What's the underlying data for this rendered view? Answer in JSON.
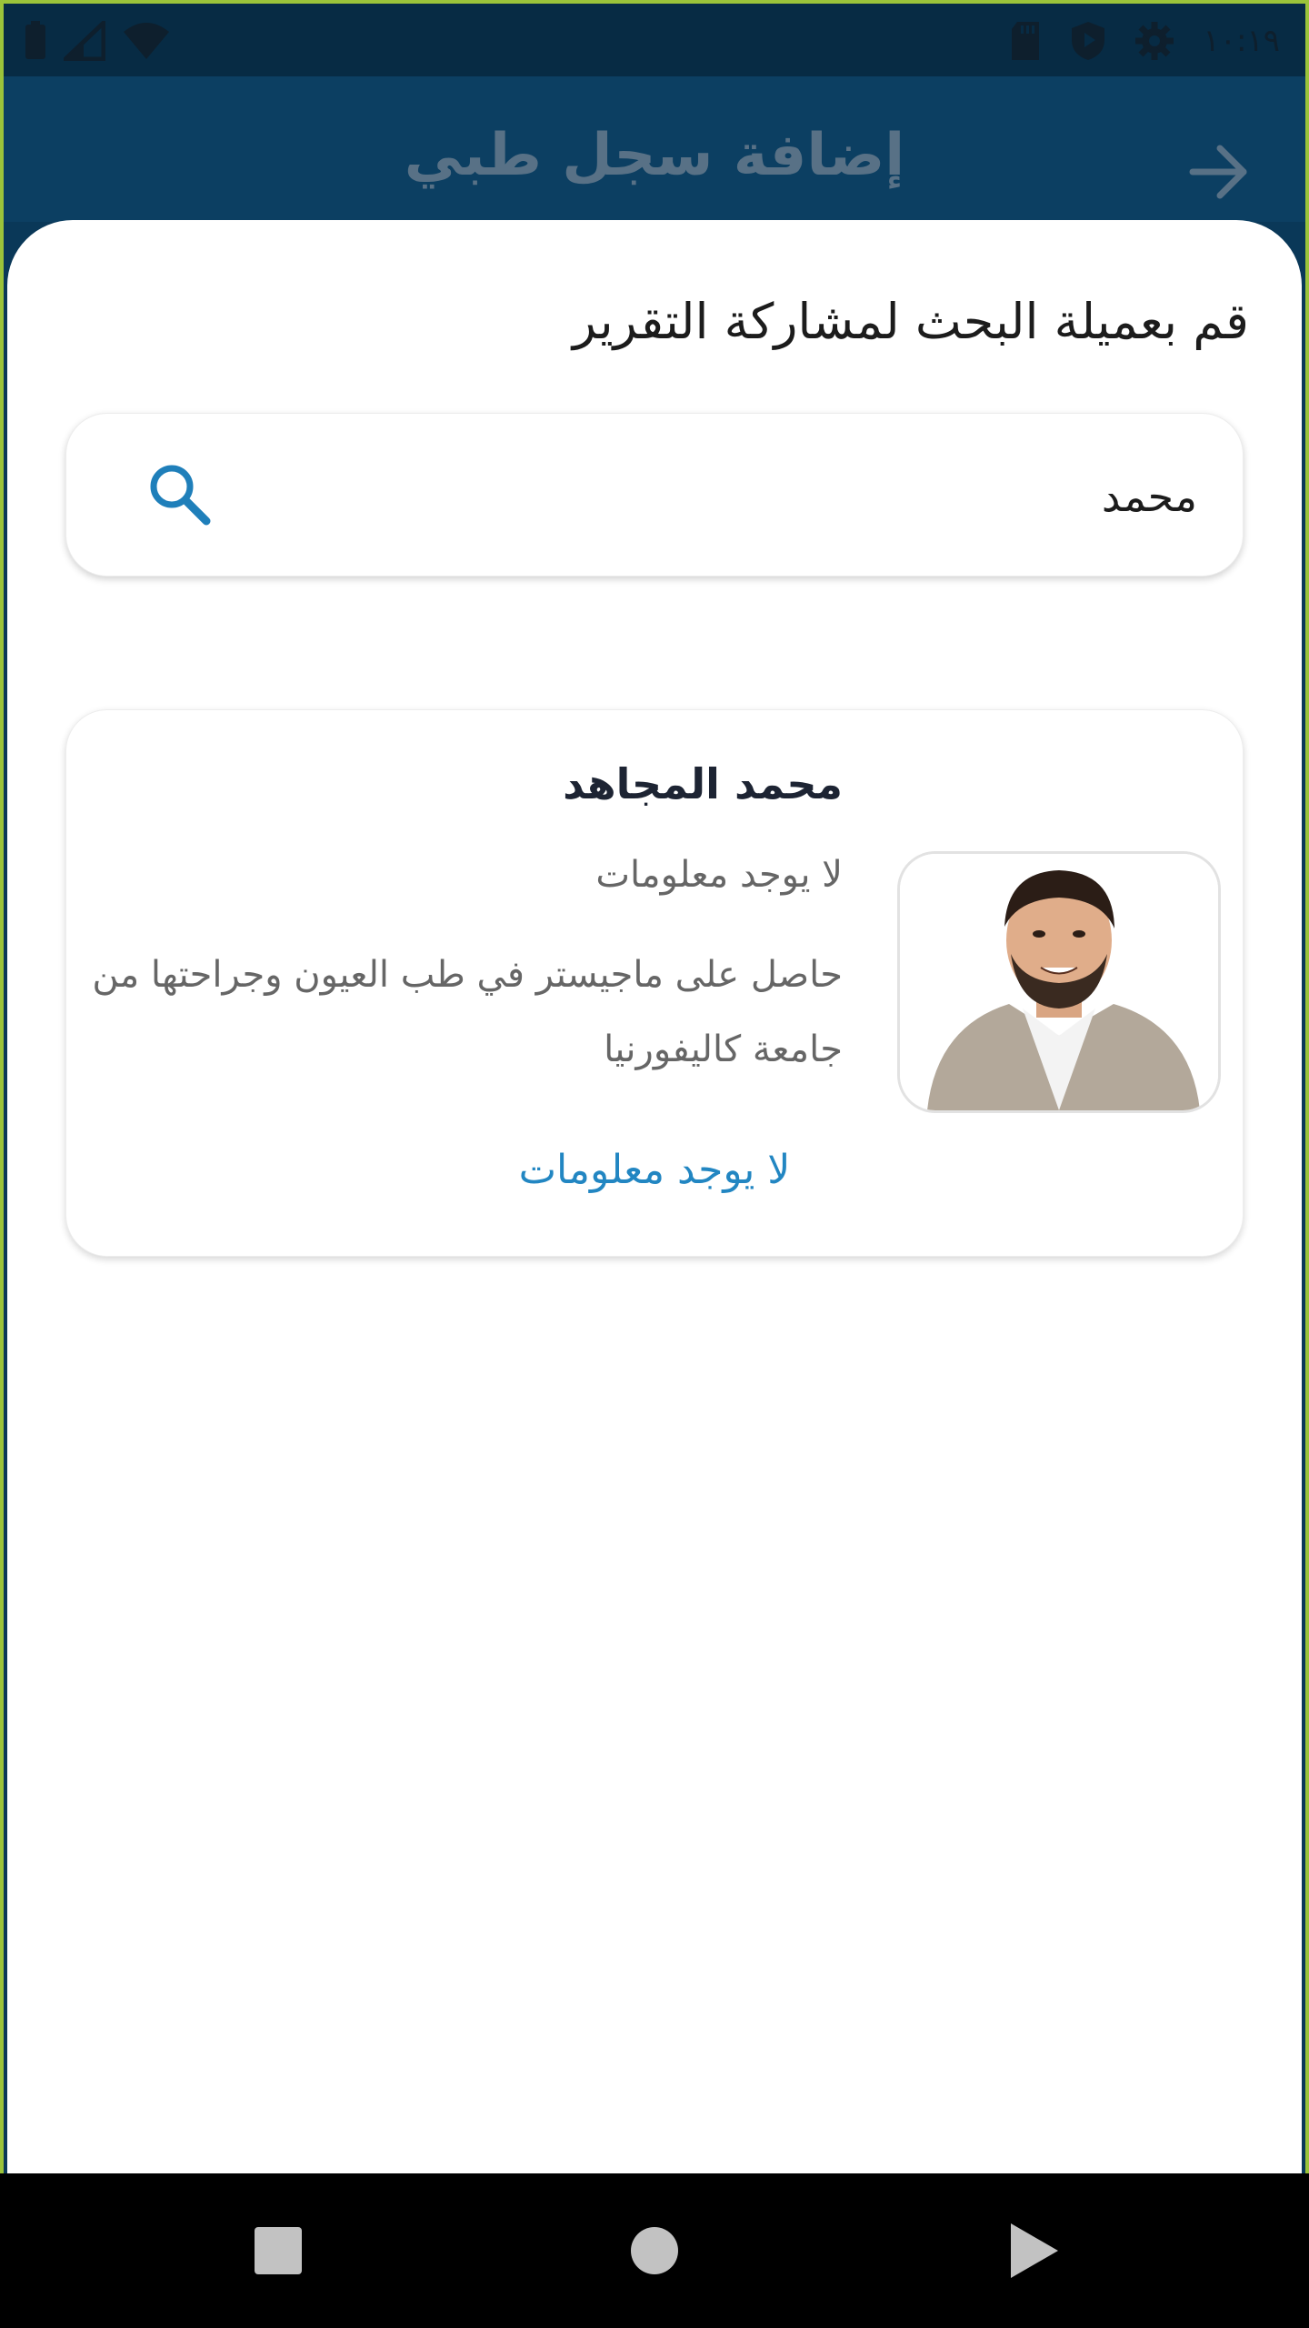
{
  "status_bar": {
    "time": "١٠:١٩",
    "left_icons": [
      "battery-icon",
      "signal-icon",
      "wifi-icon"
    ],
    "right_icons": [
      "sd-card-icon",
      "shield-icon",
      "gear-icon"
    ]
  },
  "app_bar": {
    "title": "إضافة سجل طبي",
    "back_icon": "arrow-right-icon"
  },
  "sheet": {
    "title": "قم بعميلة البحث لمشاركة التقرير",
    "search": {
      "value": "محمد",
      "placeholder": ""
    },
    "result": {
      "name": "محمد المجاهد",
      "specialty": "لا يوجد معلومات",
      "bio": "حاصل على ماجيستر في طب العيون وجراحتها من  جامعة كاليفورنيا",
      "link": "لا يوجد معلومات"
    }
  },
  "nav_bar": {
    "buttons": [
      "square-recents-icon",
      "circle-home-icon",
      "triangle-back-icon"
    ]
  },
  "colors": {
    "accent": "#2286c2",
    "app_bar": "#0c3f62",
    "status_bar": "#072b44"
  }
}
